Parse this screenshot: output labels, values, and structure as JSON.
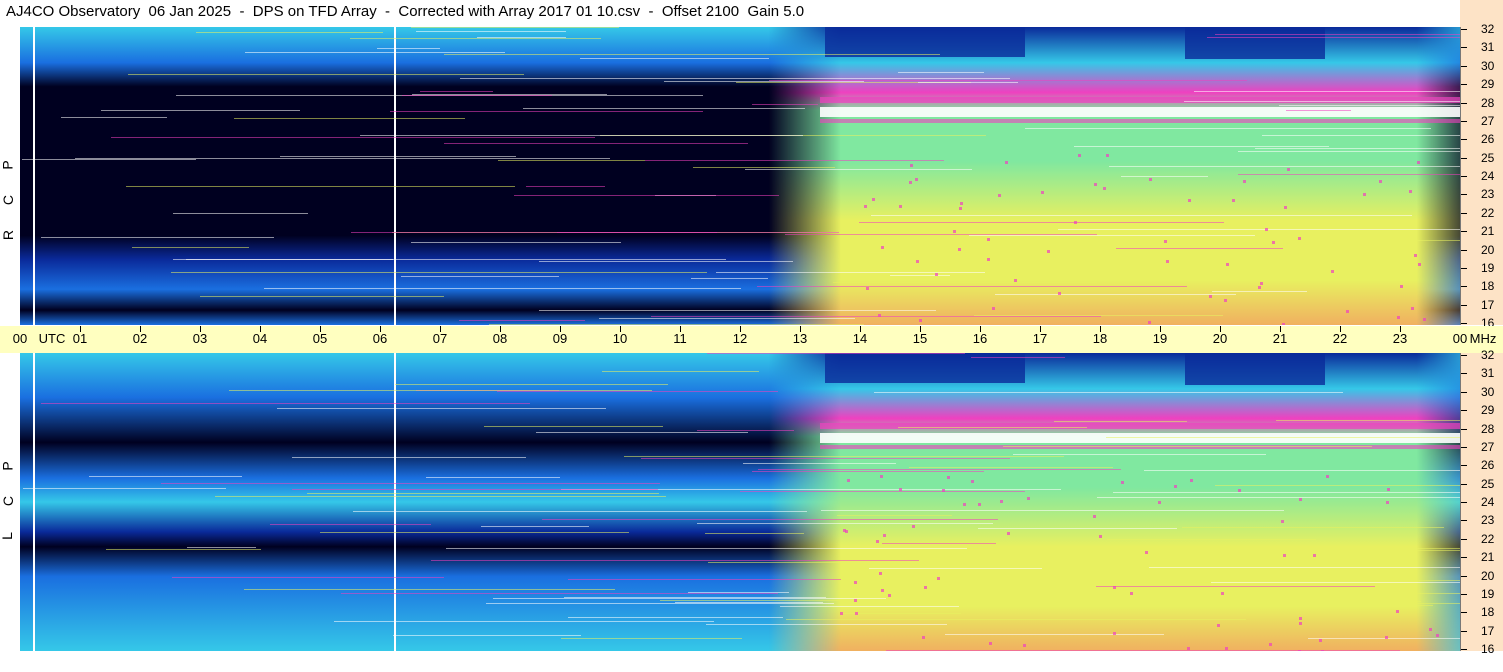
{
  "title": "AJ4CO Observatory  06 Jan 2025  -  DPS on TFD Array  -  Corrected with Array 2017 01 10.csv  -  Offset 2100  Gain 5.0",
  "chart_data": [
    {
      "type": "heatmap",
      "polarization": [
        "R",
        "C",
        "P"
      ],
      "x_unit": "UTC",
      "xlim": [
        0,
        24
      ],
      "y_unit": "MHz",
      "ylim": [
        16,
        32
      ],
      "yticks": [
        "32",
        "31",
        "30",
        "29",
        "28",
        "27",
        "26",
        "25",
        "24",
        "23",
        "22",
        "21",
        "20",
        "19",
        "18",
        "17",
        "16"
      ]
    },
    {
      "type": "heatmap",
      "polarization": [
        "L",
        "C",
        "P"
      ],
      "x_unit": "UTC",
      "xlim": [
        0,
        24
      ],
      "y_unit": "MHz",
      "ylim": [
        16,
        32
      ],
      "yticks": [
        "32",
        "31",
        "30",
        "29",
        "28",
        "27",
        "26",
        "25",
        "24",
        "23",
        "22",
        "21",
        "20",
        "19",
        "18",
        "17",
        "16"
      ]
    }
  ],
  "utc_axis": {
    "first_label": "00",
    "utc_label": "UTC",
    "ticks": [
      "01",
      "02",
      "03",
      "04",
      "05",
      "06",
      "07",
      "08",
      "09",
      "10",
      "11",
      "12",
      "13",
      "14",
      "15",
      "16",
      "17",
      "18",
      "19",
      "20",
      "21",
      "22",
      "23"
    ],
    "last_label": "00",
    "unit_label": "MHz"
  },
  "colors": {
    "night_dark": "#000020",
    "deep_blue": "#0a2a9a",
    "blue": "#1a6fe0",
    "cyan": "#35c8e8",
    "green": "#80e8a0",
    "yellow": "#e8f060",
    "orange": "#f0b060",
    "magenta": "#f040c0",
    "white_band": "#ffffff",
    "utc_bar": "#ffffc0",
    "mhz_column": "#fde3c6"
  }
}
